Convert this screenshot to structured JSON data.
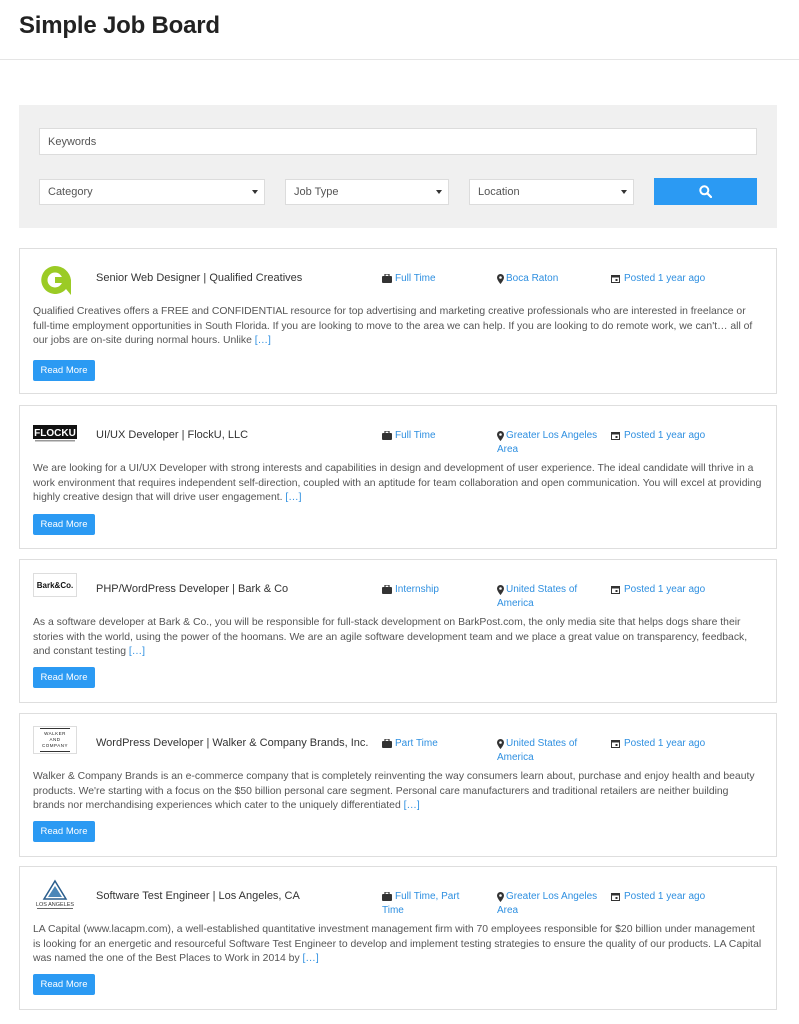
{
  "site": {
    "title": "Simple Job Board"
  },
  "search": {
    "keywords_placeholder": "Keywords",
    "category_label": "Category",
    "jobtype_label": "Job Type",
    "location_label": "Location",
    "button_icon": "search-icon"
  },
  "colors": {
    "accent": "#2b9af3",
    "link": "#2e8fe0",
    "panel": "#f0f0f0"
  },
  "jobs": [
    {
      "title": "Senior Web Designer | Qualified Creatives",
      "type": "Full Time",
      "location": "Boca Raton",
      "posted": "Posted 1 year ago",
      "description": "Qualified Creatives offers a FREE and CONFIDENTIAL resource for top advertising and marketing creative professionals who are interested in freelance or full-time employment opportunities in South Florida. If you are looking to move to the area we can help. If you are looking to do remote work, we can't… all of our jobs are on-site during normal hours. Unlike",
      "more": "[…]",
      "read_more": "Read More",
      "logo": "qualified-creatives-logo"
    },
    {
      "title": "UI/UX Developer | FlockU, LLC",
      "type": "Full Time",
      "location": "Greater Los Angeles Area",
      "posted": "Posted 1 year ago",
      "description": "We are looking for a UI/UX Developer with strong interests and capabilities in design and development of user experience.  The ideal candidate will thrive in a work environment that requires independent self-direction, coupled with an aptitude for team collaboration and open communication.  You will excel at providing highly creative design that will drive user engagement.",
      "more": "[…]",
      "read_more": "Read More",
      "logo": "flocku-logo",
      "logo_text": "FLOCKU"
    },
    {
      "title": "PHP/WordPress Developer | Bark & Co",
      "type": "Internship",
      "location": "United States of America",
      "posted": "Posted 1 year ago",
      "description": "As a software developer at Bark & Co., you will be responsible for full-stack development on BarkPost.com, the only media site that helps dogs share their stories with the world, using the power of the hoomans. We are an agile software development team and we place a great value on transparency, feedback, and constant testing",
      "more": "[…]",
      "read_more": "Read More",
      "logo": "bark-and-co-logo",
      "logo_text": "Bark&Co."
    },
    {
      "title": "WordPress Developer | Walker & Company Brands, Inc.",
      "type": "Part Time",
      "location": "United States of America",
      "posted": "Posted 1 year ago",
      "description": "Walker & Company Brands is an e-commerce company that is completely reinventing the way consumers learn about, purchase and enjoy health and beauty products. We're starting with a focus on the $50 billion personal care segment. Personal care manufacturers and traditional retailers are neither building brands nor merchandising experiences which cater to the uniquely differentiated",
      "more": "[…]",
      "read_more": "Read More",
      "logo": "walker-and-company-logo",
      "logo_text": "WALKER AND COMPANY"
    },
    {
      "title": "Software Test Engineer | Los Angeles, CA",
      "type": "Full Time, Part Time",
      "location": "Greater Los Angeles Area",
      "posted": "Posted 1 year ago",
      "description": "LA Capital (www.lacapm.com), a well-established quantitative investment management firm with 70 employees responsible for $20 billion under management is looking for an energetic and resourceful Software Test Engineer to develop and implement testing strategies to ensure the quality of our products. LA Capital was named the one of the Best Places to Work in 2014 by",
      "more": "[…]",
      "read_more": "Read More",
      "logo": "la-capital-logo",
      "logo_text": "LOS ANGELES"
    }
  ]
}
